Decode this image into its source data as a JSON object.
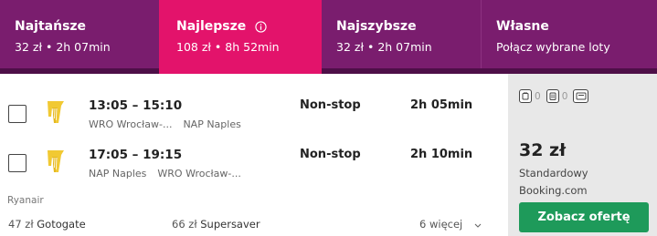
{
  "tabs": [
    {
      "title": "Najtańsze",
      "sub": "32 zł • 2h 07min"
    },
    {
      "title": "Najlepsze",
      "sub": "108 zł • 8h 52min"
    },
    {
      "title": "Najszybsze",
      "sub": "32 zł • 2h 07min"
    },
    {
      "title": "Własne",
      "sub": "Połącz wybrane loty"
    }
  ],
  "active_tab": "Najlepsze",
  "colors": {
    "tab_bg": "#7a1d6e",
    "tab_active": "#e3136b",
    "cta": "#1e9a5a",
    "logo": "#f1c933"
  },
  "flights": {
    "outbound": {
      "times": "13:05 – 15:10",
      "from": "WRO Wrocław-...",
      "to": "NAP Naples",
      "stops": "Non-stop",
      "duration": "2h 05min"
    },
    "inbound": {
      "times": "17:05 – 19:15",
      "from": "NAP Naples",
      "to": "WRO Wrocław-...",
      "stops": "Non-stop",
      "duration": "2h 10min"
    },
    "carrier": "Ryanair"
  },
  "other_offers": [
    {
      "price": "47 zł",
      "site": "Gotogate"
    },
    {
      "price": "66 zł",
      "site": "Supersaver"
    }
  ],
  "more_offers": "6 więcej",
  "price_panel": {
    "bags": [
      {
        "icon": "cabin-bag-icon",
        "count": "0"
      },
      {
        "icon": "checked-bag-icon",
        "count": "0"
      },
      {
        "icon": "seat-icon"
      }
    ],
    "price": "32 zł",
    "fare_type": "Standardowy",
    "provider": "Booking.com",
    "cta": "Zobacz ofertę"
  }
}
